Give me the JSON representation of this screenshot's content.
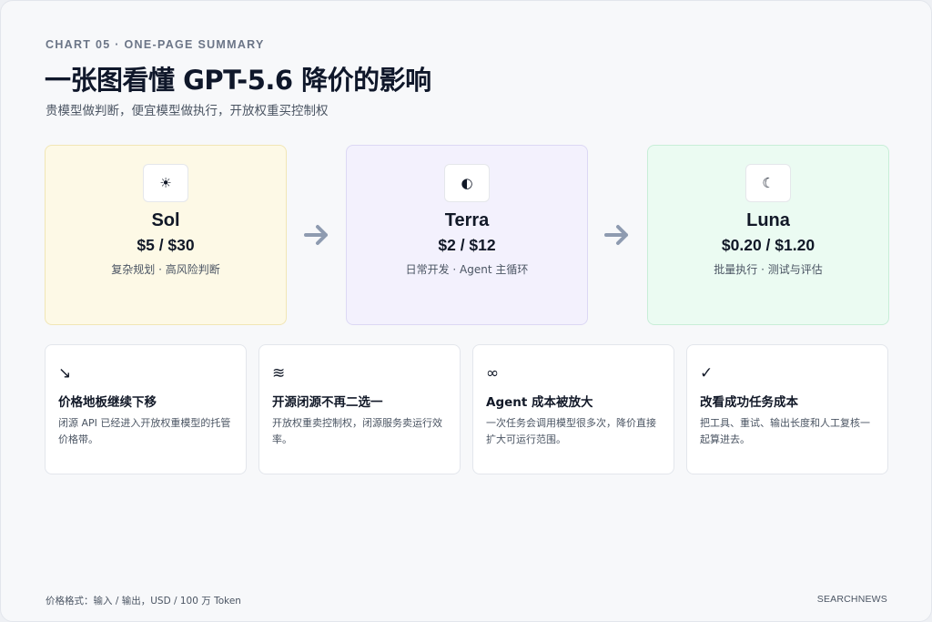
{
  "eyebrow": "CHART 05 · ONE-PAGE SUMMARY",
  "title": "一张图看懂 GPT-5.6 降价的影响",
  "subtitle": "贵模型做判断，便宜模型做执行，开放权重买控制权",
  "tiers": [
    {
      "name": "Sol",
      "price": "$5 / $30",
      "desc": "复杂规划 · 高风险判断",
      "icon": "sun-icon",
      "icon_glyph": "☀",
      "bg": "#fdf9e6",
      "border": "#f1e6b5"
    },
    {
      "name": "Terra",
      "price": "$2 / $12",
      "desc": "日常开发 · Agent 主循环",
      "icon": "half-circle-icon",
      "icon_glyph": "◐",
      "bg": "#f3f1fd",
      "border": "#dcd8f4"
    },
    {
      "name": "Luna",
      "price": "$0.20 / $1.20",
      "desc": "批量执行 · 测试与评估",
      "icon": "moon-icon",
      "icon_glyph": "☾",
      "bg": "#ebfbf2",
      "border": "#c8eed8"
    }
  ],
  "arrow_color": "#8e9bb0",
  "cards": [
    {
      "icon": "trend-down-icon",
      "icon_glyph": "↘",
      "title": "价格地板继续下移",
      "desc": "闭源 API 已经进入开放权重模型的托管价格带。"
    },
    {
      "icon": "approx-icon",
      "icon_glyph": "≋",
      "title": "开源闭源不再二选一",
      "desc": "开放权重卖控制权，闭源服务卖运行效率。"
    },
    {
      "icon": "infinity-icon",
      "icon_glyph": "∞",
      "title": "Agent 成本被放大",
      "desc": "一次任务会调用模型很多次，降价直接扩大可运行范围。"
    },
    {
      "icon": "check-icon",
      "icon_glyph": "✓",
      "title": "改看成功任务成本",
      "desc": "把工具、重试、输出长度和人工复核一起算进去。"
    }
  ],
  "footnote": "价格格式：输入 / 输出，USD / 100 万 Token",
  "brand": "SEARCHNEWS"
}
